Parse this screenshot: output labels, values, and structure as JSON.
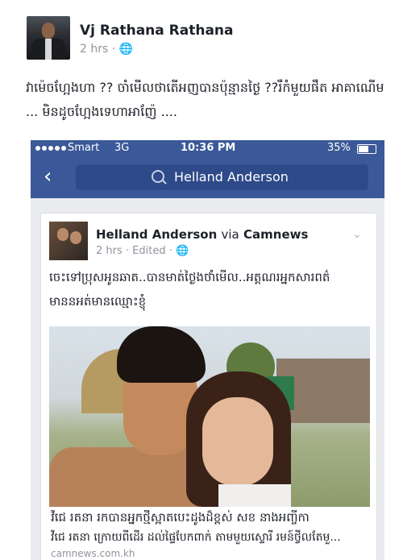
{
  "post": {
    "author": "Vj Rathana Rathana",
    "time": "2 hrs ·",
    "privacy_icon": "globe-icon",
    "status_text": "វាម៉េចហ្អែងហា ?? ចាំមើលថាតើអញបានប៉ុន្មានថ្ងៃ ??រឹកំមួយផឹត អាគាណើម ... មិនដូចហ្អែងទេហាអាញ៉ែ ...."
  },
  "screenshot": {
    "status_bar": {
      "carrier": "Smart",
      "network": "3G",
      "time": "10:36 PM",
      "battery": "35%"
    },
    "nav": {
      "back_icon": "back-chevron-icon",
      "search_query": "Helland Anderson"
    },
    "shared_post": {
      "author": "Helland Anderson",
      "via_label": "via",
      "page": "Camnews",
      "meta": "2 hrs · Edited ·",
      "status_text": "ចេះទៅប្រុសអូនឆាត..បានមាត់ថ្ងៃងថាំមើល..អត្តណរអ្នកសារពត៌ មាននអត់មានឈ្មោះខ្ញុំ",
      "link_title": "វីជេ រតនា រកបានអ្នកថ្មីស្អាតបេះដូងដ៏ខ្ពស់ សខ នាងអញ្ចីកា",
      "link_description": "វីជេ រតនា ក្រោយពីដើរ ដល់ផ្ទៃបែកពាក់ តាមមួយស្ទោរី រមន៍ថ្វីលតែមួ...",
      "link_domain": "camnews.com.kh"
    }
  }
}
